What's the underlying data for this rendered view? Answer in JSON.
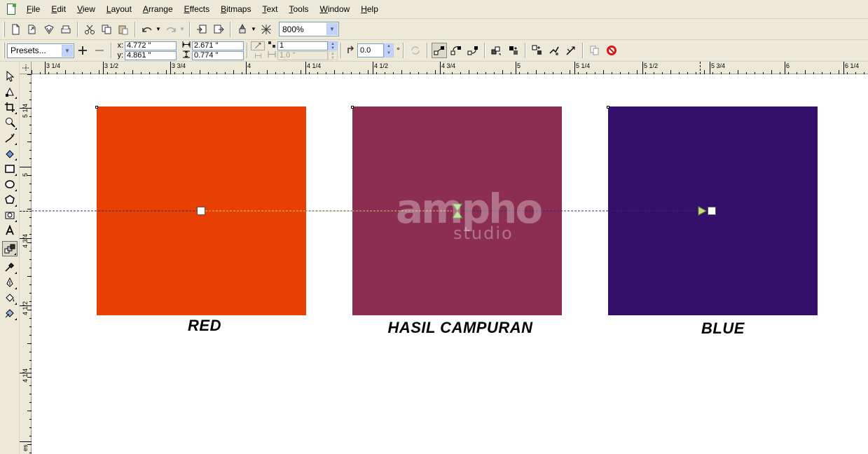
{
  "menubar": {
    "items": [
      {
        "label": "File",
        "mnemonic": "F",
        "rest": "ile"
      },
      {
        "label": "Edit",
        "mnemonic": "E",
        "rest": "dit"
      },
      {
        "label": "View",
        "mnemonic": "V",
        "rest": "iew"
      },
      {
        "label": "Layout",
        "mnemonic": "L",
        "rest": "ayout"
      },
      {
        "label": "Arrange",
        "mnemonic": "A",
        "rest": "rrange"
      },
      {
        "label": "Effects",
        "mnemonic": "E",
        "rest": "ffects"
      },
      {
        "label": "Bitmaps",
        "mnemonic": "B",
        "rest": "itmaps"
      },
      {
        "label": "Text",
        "mnemonic": "T",
        "rest": "ext"
      },
      {
        "label": "Tools",
        "mnemonic": "T",
        "rest": "ools"
      },
      {
        "label": "Window",
        "mnemonic": "W",
        "rest": "indow"
      },
      {
        "label": "Help",
        "mnemonic": "H",
        "rest": "elp"
      }
    ]
  },
  "toolbar": {
    "zoom_value": "800%"
  },
  "property_bar": {
    "presets_value": "Presets...",
    "x_label": "x:",
    "y_label": "y:",
    "x_value": "4.772 \"",
    "y_value": "4.861 \"",
    "width_value": "2.671 \"",
    "height_value": "0.774 \"",
    "steps_value": "1",
    "spacing_value": "1.0 \"",
    "angle_value": "0.0",
    "angle_unit": "°"
  },
  "ruler_h": {
    "labels": [
      {
        "text": "3  1/4",
        "pos": 21
      },
      {
        "text": "3  1/2",
        "pos": 104
      },
      {
        "text": "3  3/4",
        "pos": 200
      },
      {
        "text": "4",
        "pos": 308
      },
      {
        "text": "4  1/4",
        "pos": 393
      },
      {
        "text": "4  1/2",
        "pos": 489
      },
      {
        "text": "4  3/4",
        "pos": 585
      },
      {
        "text": "5",
        "pos": 693
      },
      {
        "text": "5  1/4",
        "pos": 777
      },
      {
        "text": "5  1/2",
        "pos": 874
      },
      {
        "text": "5  3/4",
        "pos": 970
      },
      {
        "text": "6",
        "pos": 1077
      },
      {
        "text": "6  1/4",
        "pos": 1161
      }
    ]
  },
  "ruler_v": {
    "labels": [
      {
        "text": "5  1/4",
        "pos": 62
      },
      {
        "text": "5",
        "pos": 146
      },
      {
        "text": "4  3/4",
        "pos": 248
      },
      {
        "text": "4  1/2",
        "pos": 344
      },
      {
        "text": "4  1/4",
        "pos": 440
      },
      {
        "text": "es",
        "pos": 538
      }
    ]
  },
  "canvas": {
    "swatches": [
      {
        "name": "red",
        "color": "#e83f02",
        "caption": "RED"
      },
      {
        "name": "blend",
        "color": "#8b2e51",
        "caption": "HASIL CAMPURAN"
      },
      {
        "name": "blue",
        "color": "#34106c",
        "caption": "BLUE"
      }
    ],
    "watermark": {
      "main": "ampho",
      "sub": "studio"
    }
  },
  "colors": {
    "chrome": "#ece9d8",
    "red": "#e83f02",
    "blend": "#8b2e51",
    "blue": "#34106c"
  }
}
